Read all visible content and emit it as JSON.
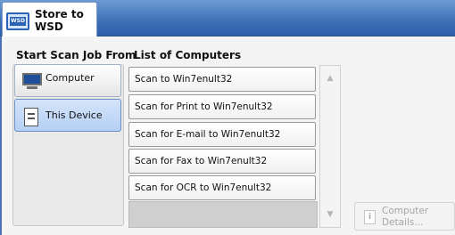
{
  "window": {
    "title_line1": "Store to",
    "title_line2": "WSD",
    "icon_label": "WSD"
  },
  "source": {
    "heading": "Start Scan Job From",
    "options": [
      {
        "label": "Computer",
        "icon": "monitor-icon",
        "selected": false
      },
      {
        "label": "This Device",
        "icon": "device-icon",
        "selected": true
      }
    ]
  },
  "computers": {
    "heading": "List of Computers",
    "items": [
      "Scan to Win7enult32",
      "Scan for Print to Win7enult32",
      "Scan for E-mail to Win7enult32",
      "Scan for Fax to Win7enult32",
      "Scan for OCR to Win7enult32"
    ]
  },
  "scroll": {
    "up_icon": "▲",
    "down_icon": "▼"
  },
  "details_button": {
    "line1": "Computer",
    "line2": "Details...",
    "icon": "info-icon",
    "icon_glyph": "i"
  },
  "colors": {
    "header": "#3c6fb5",
    "selected": "#b5cff3"
  }
}
